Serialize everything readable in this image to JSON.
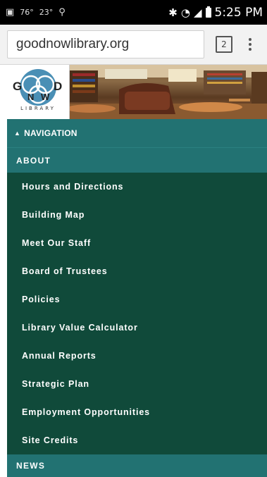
{
  "status_bar": {
    "temp": "76°",
    "temp2": "23°",
    "time": "5:25 PM",
    "icons": [
      "image-icon",
      "temperature-icon",
      "usb-icon",
      "bluetooth-icon",
      "wifi-icon",
      "signal-icon",
      "battery-icon"
    ]
  },
  "browser": {
    "url": "goodnowlibrary.org",
    "tab_count": "2",
    "menu_icon": "more-vertical-icon"
  },
  "logo": {
    "letters_top": "G    D",
    "letters_mid": "N  W",
    "caption": "LIBRARY"
  },
  "nav": {
    "toggle_label": "NAVIGATION",
    "section_label": "ABOUT",
    "items": [
      "Hours and Directions",
      "Building Map",
      "Meet Our Staff",
      "Board of Trustees",
      "Policies",
      "Library Value Calculator",
      "Annual Reports",
      "Strategic Plan",
      "Employment Opportunities",
      "Site Credits"
    ],
    "next_section_label": "NEWS"
  },
  "colors": {
    "nav_teal": "#227272",
    "submenu_dark_green": "#104a3a",
    "logo_blue": "#4a8fb5"
  }
}
